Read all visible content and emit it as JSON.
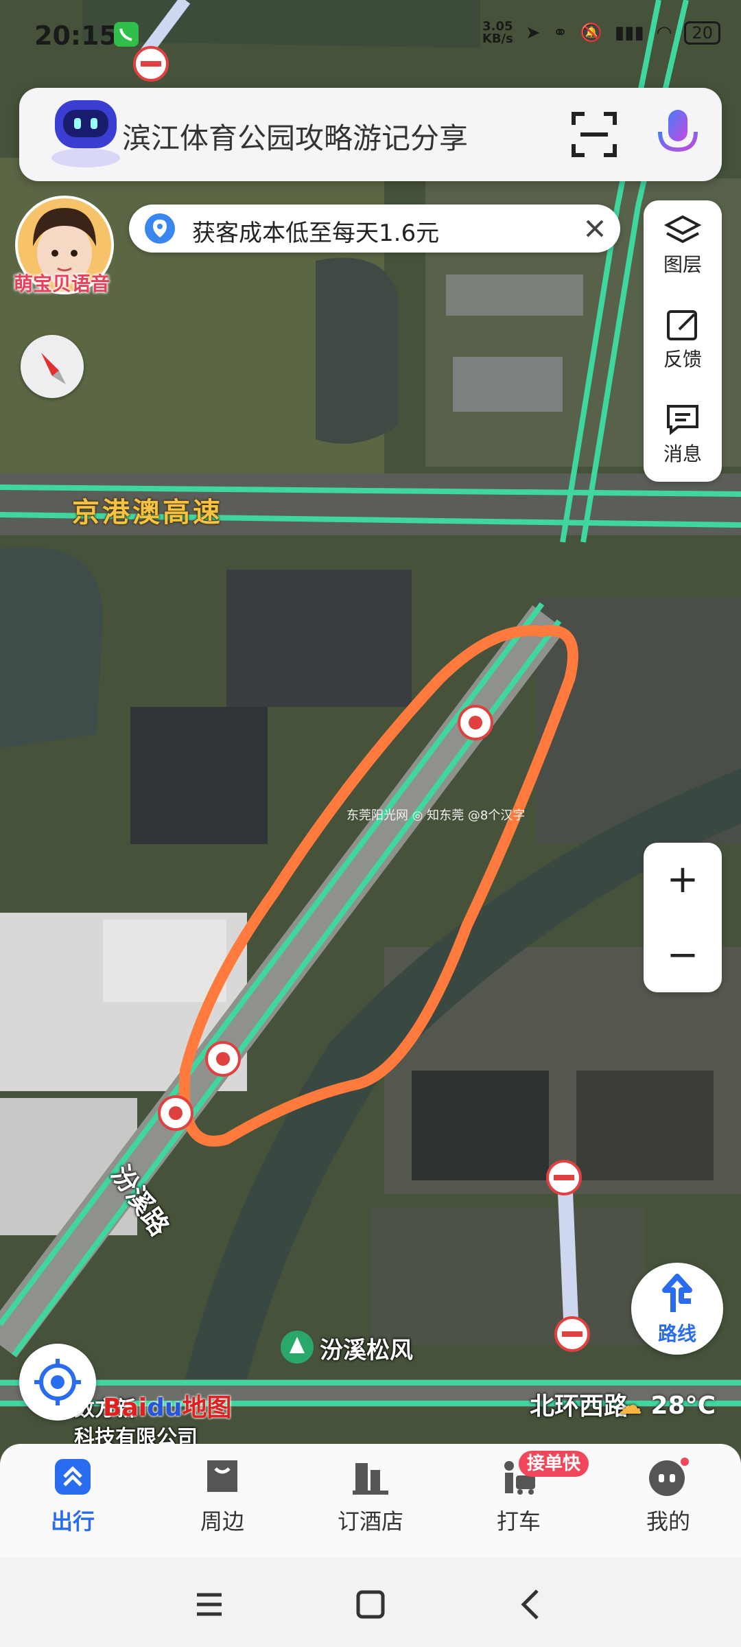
{
  "status_bar": {
    "time": "20:15",
    "net_speed": "3.05\nKB/s",
    "battery": "20"
  },
  "search": {
    "query": "滨江体育公园攻略游记分享"
  },
  "promo": {
    "text": "获客成本低至每天1.6元"
  },
  "voice": {
    "label": "萌宝贝语音"
  },
  "side_panel": {
    "layers": "图层",
    "feedback": "反馈",
    "messages": "消息"
  },
  "zoom": {
    "plus": "+",
    "minus": "−"
  },
  "map_labels": {
    "highway": "京港澳高速",
    "road_fenxi": "汾溪路",
    "poi": "汾溪松风",
    "road_bottom": "北环西路",
    "company_line1": "数方新",
    "company_line2": "科技有限公司",
    "watermark": "东莞阳光网 ◎ 知东莞 @8个汉字"
  },
  "weather": {
    "temp": "28°C"
  },
  "logo": {
    "part1": "Bai",
    "part2": "du",
    "part3": "地图"
  },
  "route_button": {
    "label": "路线"
  },
  "bottom_nav": {
    "items": [
      {
        "label": "出行",
        "icon": "travel-icon"
      },
      {
        "label": "周边",
        "icon": "nearby-icon"
      },
      {
        "label": "订酒店",
        "icon": "hotel-icon"
      },
      {
        "label": "打车",
        "icon": "taxi-icon"
      },
      {
        "label": "我的",
        "icon": "profile-icon"
      }
    ],
    "badge": "接单快",
    "active_index": 0
  },
  "colors": {
    "accent": "#2a6cf0",
    "road": "#3fd6a0",
    "highlight": "#ff7a3c"
  }
}
